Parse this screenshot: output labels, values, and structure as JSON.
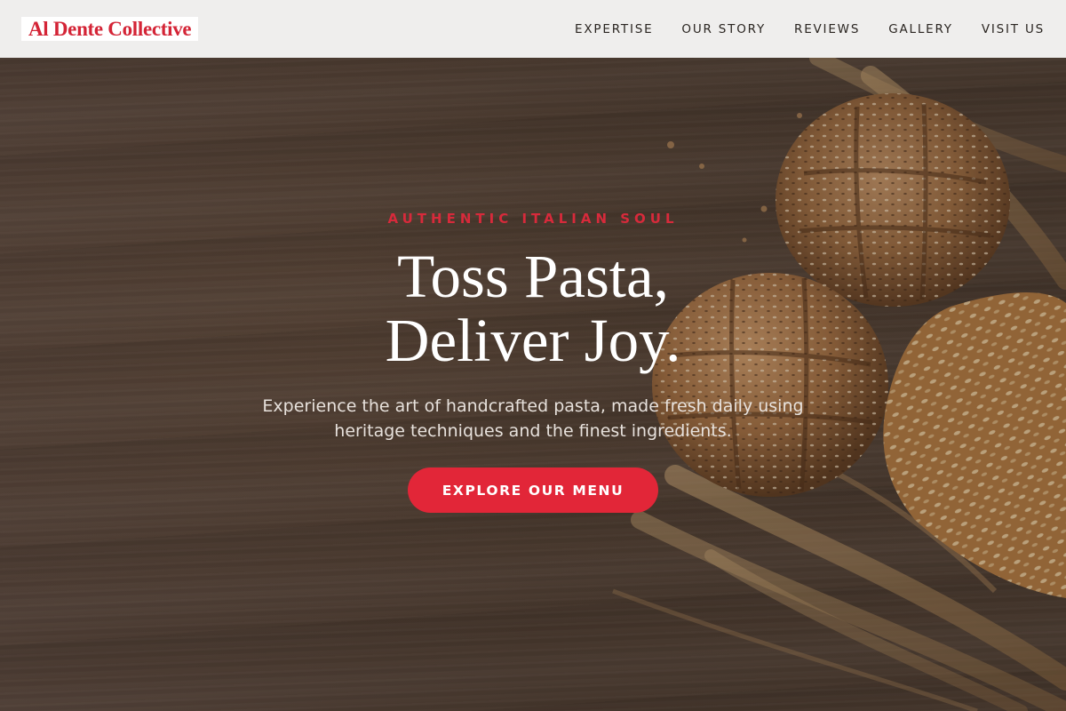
{
  "brand": {
    "name": "Al Dente Collective",
    "accent_color": "#e22638"
  },
  "nav": {
    "items": [
      {
        "label": "EXPERTISE"
      },
      {
        "label": "OUR STORY"
      },
      {
        "label": "REVIEWS"
      },
      {
        "label": "GALLERY"
      },
      {
        "label": "VISIT US"
      }
    ]
  },
  "hero": {
    "eyebrow": "AUTHENTIC ITALIAN SOUL",
    "headline_line1": "Toss Pasta,",
    "headline_line2": "Deliver Joy.",
    "subtext_line1": "Experience the art of handcrafted pasta, made fresh daily using",
    "subtext_line2": "heritage techniques and the finest ingredients.",
    "cta_label": "EXPLORE OUR MENU",
    "background": "bread-loaves-wheat-wood-photo"
  }
}
